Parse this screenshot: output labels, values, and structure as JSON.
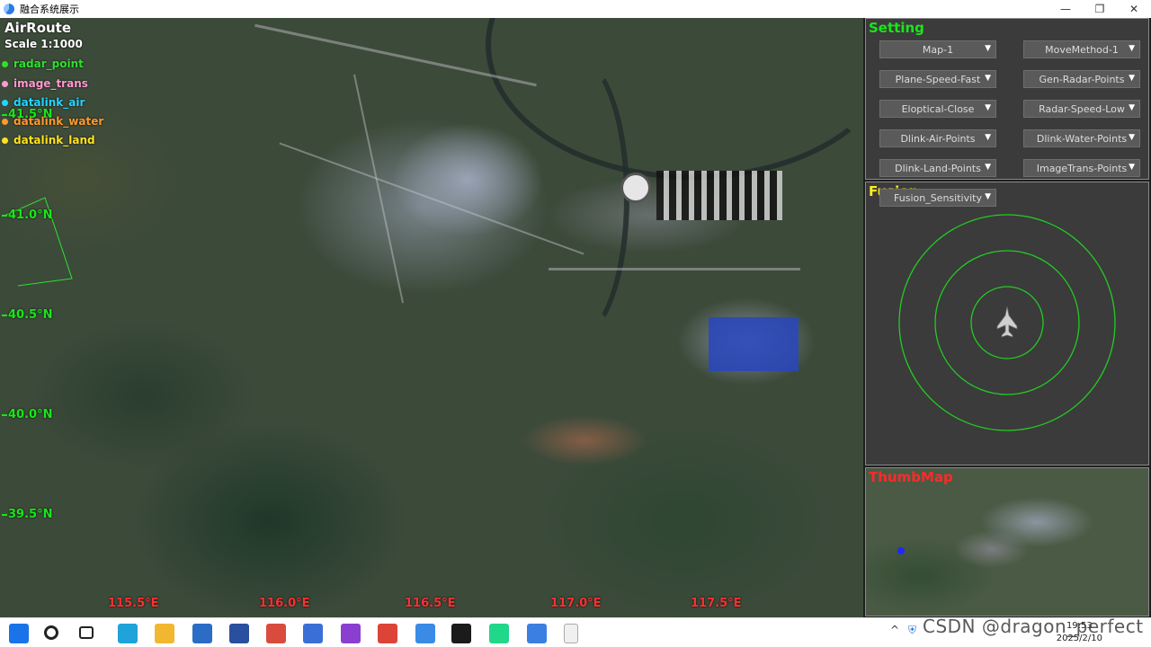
{
  "window": {
    "title": "融合系统展示",
    "minimize_glyph": "—",
    "maximize_glyph": "❐",
    "close_glyph": "✕"
  },
  "map": {
    "title": "AirRoute",
    "scale": "Scale 1:1000",
    "legend": [
      {
        "label": "radar_point",
        "color": "#2fe02f"
      },
      {
        "label": "image_trans",
        "color": "#ff9ad0"
      },
      {
        "label": "datalink_air",
        "color": "#23d6ff"
      },
      {
        "label": "datalink_water",
        "color": "#ff9a2e"
      },
      {
        "label": "datalink_land",
        "color": "#ffe21f"
      }
    ],
    "latitudes": [
      "41.5°N",
      "41.0°N",
      "40.5°N",
      "40.0°N",
      "39.5°N"
    ],
    "longitudes": [
      "115.5°E",
      "116.0°E",
      "116.5°E",
      "117.0°E",
      "117.5°E"
    ],
    "lat_color": "#19e619",
    "lon_color": "#ff3030"
  },
  "setting": {
    "title": "Setting",
    "title_color": "#19e619",
    "dropdowns": [
      "Map-1",
      "MoveMethod-1",
      "Plane-Speed-Fast",
      "Gen-Radar-Points",
      "Eloptical-Close",
      "Radar-Speed-Low",
      "Dlink-Air-Points",
      "Dlink-Water-Points",
      "Dlink-Land-Points",
      "ImageTrans-Points"
    ],
    "arrow_glyph": "▼"
  },
  "fusion": {
    "title": "Fusion",
    "title_color": "#ffee22",
    "dropdown": "Fusion_Sensitivity",
    "ring_color": "#22cc22",
    "plane_icon": "fighter-jet-icon"
  },
  "thumb": {
    "title": "ThumbMap",
    "title_color": "#ff2a2a"
  },
  "taskbar": {
    "apps": [
      {
        "name": "windows-start-icon",
        "color": "#1a73e8"
      },
      {
        "name": "search-icon",
        "color": "#222222"
      },
      {
        "name": "task-view-icon",
        "color": "#222222"
      },
      {
        "name": "edge-browser-icon",
        "color": "#1fa3d8"
      },
      {
        "name": "file-explorer-icon",
        "color": "#f2b731"
      },
      {
        "name": "calculator-icon",
        "color": "#2b6cc4"
      },
      {
        "name": "document-app-icon",
        "color": "#2a4f9e"
      },
      {
        "name": "paint-app-icon",
        "color": "#d94c3d"
      },
      {
        "name": "power-automate-icon",
        "color": "#3a6fd8"
      },
      {
        "name": "visual-studio-icon",
        "color": "#8a3fd1"
      },
      {
        "name": "chrome-icon",
        "color": "#db4437"
      },
      {
        "name": "feishu-icon",
        "color": "#3a8be6"
      },
      {
        "name": "terminal-icon",
        "color": "#1b1b1b"
      },
      {
        "name": "pycharm-icon",
        "color": "#21d789"
      },
      {
        "name": "network-app-icon",
        "color": "#3b7fe3"
      },
      {
        "name": "blank-document-icon",
        "color": "#f0f0f0"
      }
    ],
    "tray_chevron": "^",
    "time": "19:53",
    "date": "2025/2/10",
    "watermark": "CSDN @dragon_perfect"
  }
}
